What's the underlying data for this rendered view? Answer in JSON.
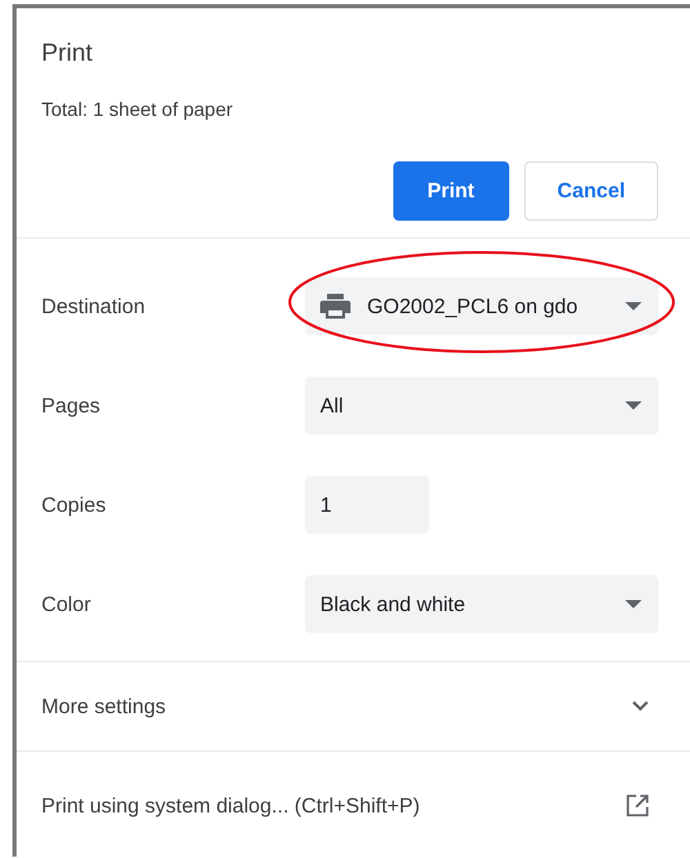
{
  "title": "Print",
  "summary": "Total: 1 sheet of paper",
  "buttons": [
    {
      "label": "Print",
      "kind": "primary"
    },
    {
      "label": "Cancel",
      "kind": "secondary"
    }
  ],
  "settings": [
    {
      "label": "Destination",
      "kind": "printer-select",
      "value": "GO2002_PCL6 on gdo",
      "highlighted": true
    },
    {
      "label": "Pages",
      "kind": "select",
      "value": "All",
      "highlighted": false
    },
    {
      "label": "Copies",
      "kind": "input",
      "value": "1",
      "highlighted": false
    },
    {
      "label": "Color",
      "kind": "select",
      "value": "Black and white",
      "highlighted": false
    }
  ],
  "more_settings": {
    "label": "More settings",
    "expanded": false
  },
  "system_dialog": {
    "label": "Print using system dialog... (Ctrl+Shift+P)"
  }
}
